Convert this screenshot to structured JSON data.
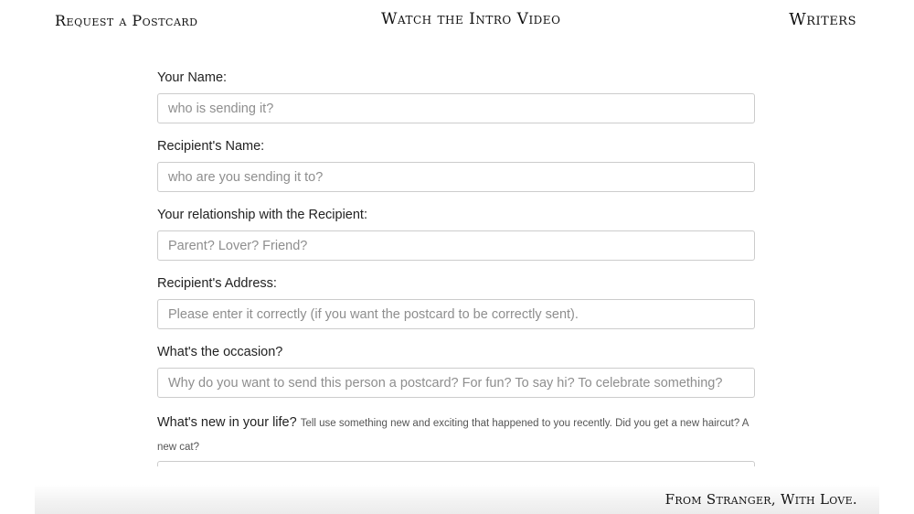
{
  "nav": {
    "request_postcard": "Request a Postcard",
    "intro_video": "Watch the Intro Video",
    "writers": "Writers"
  },
  "form": {
    "your_name": {
      "label": "Your Name:",
      "placeholder": "who is sending it?",
      "value": ""
    },
    "recipient_name": {
      "label": "Recipient's Name:",
      "placeholder": "who are you sending it to?",
      "value": ""
    },
    "relationship": {
      "label": "Your relationship with the Recipient:",
      "placeholder": "Parent? Lover? Friend?",
      "value": ""
    },
    "recipient_address": {
      "label": "Recipient's Address:",
      "placeholder": "Please enter it correctly (if you want the postcard to be correctly sent).",
      "value": ""
    },
    "occasion": {
      "label": "What's the occasion?",
      "placeholder": "Why do you want to send this person a postcard? For fun? To say hi? To celebrate something?",
      "value": ""
    },
    "whats_new": {
      "label": "What's new in your life?",
      "hint": "Tell use something new and exciting that happened to you recently. Did you get a new haircut? A new cat?",
      "value": ""
    }
  },
  "footer": {
    "tagline": "From Stranger, With Love."
  }
}
